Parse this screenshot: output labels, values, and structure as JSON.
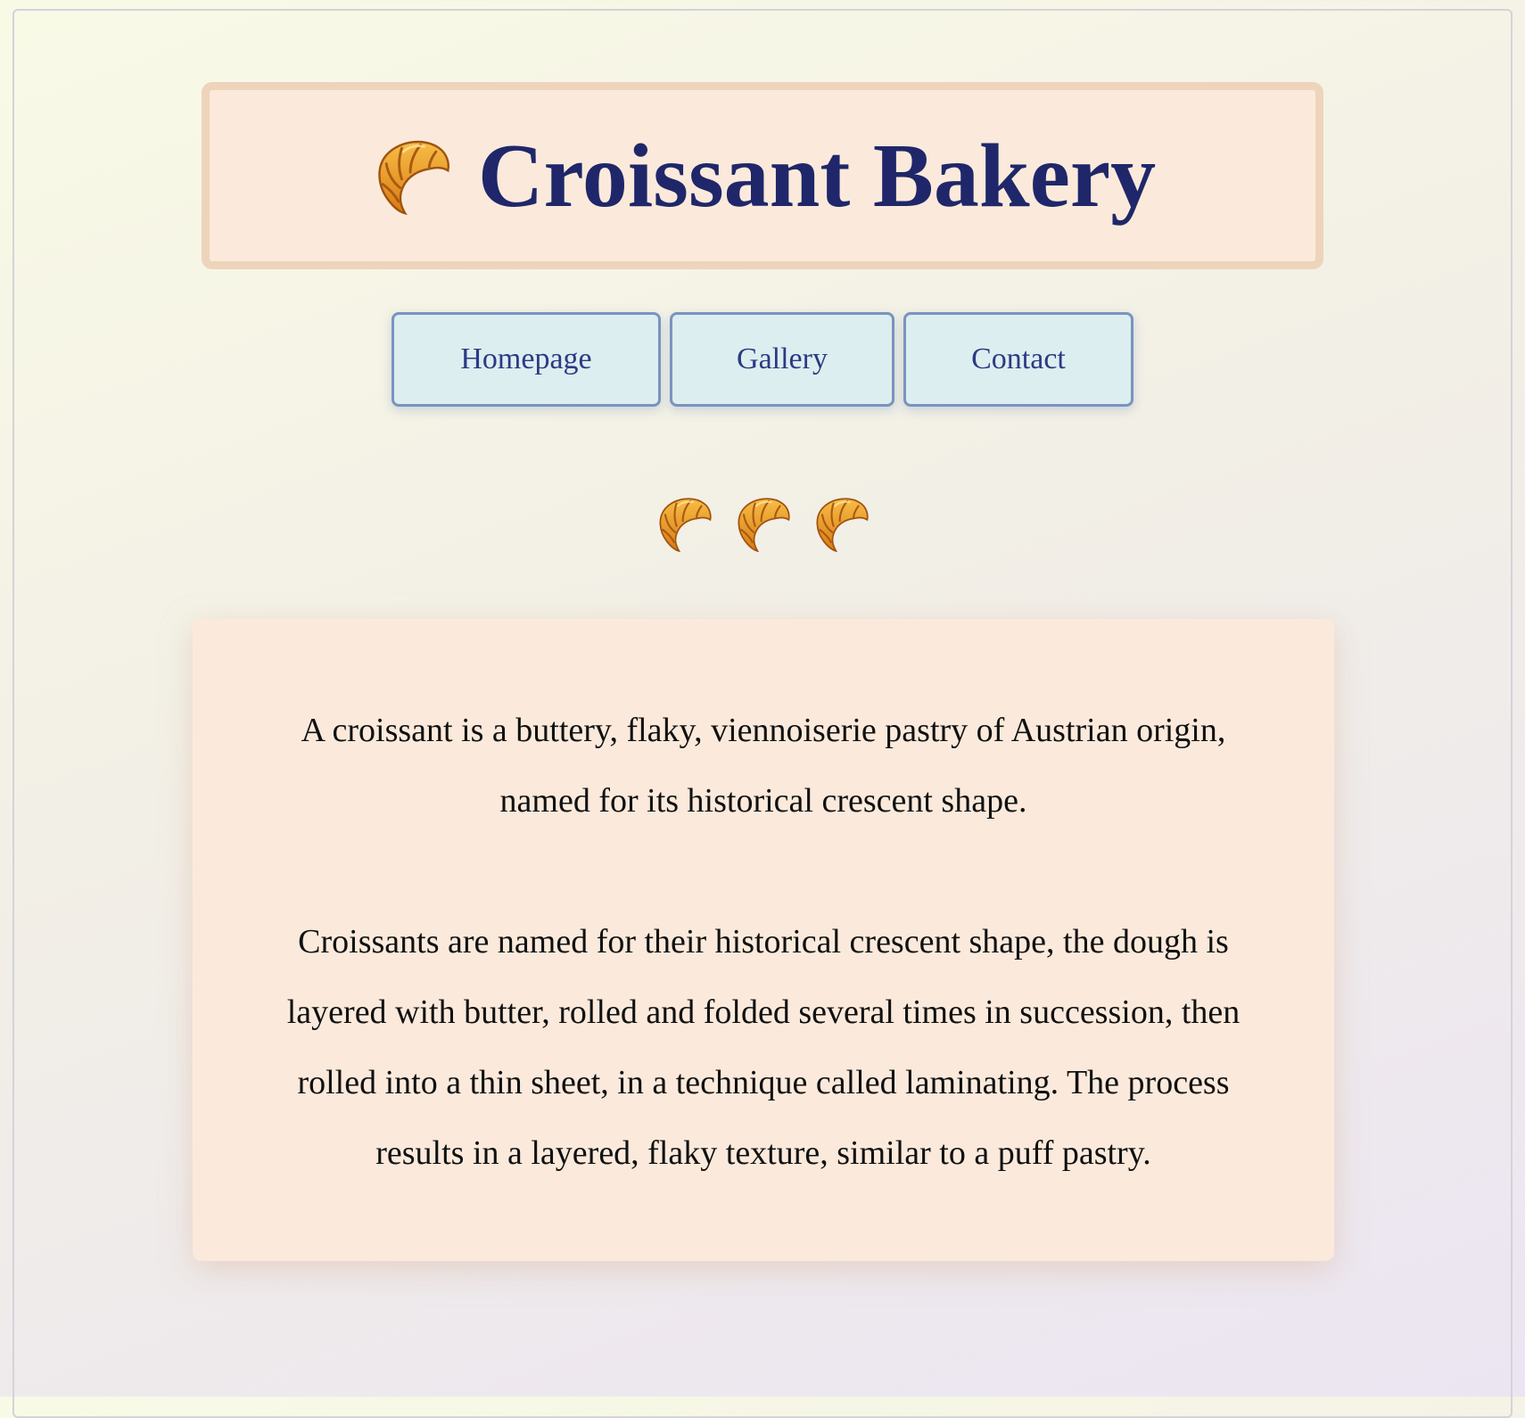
{
  "header": {
    "title": "Croissant Bakery",
    "title_icon": "croissant-icon"
  },
  "nav": {
    "items": [
      {
        "label": "Homepage"
      },
      {
        "label": "Gallery"
      },
      {
        "label": "Contact"
      }
    ]
  },
  "decoration": {
    "icon": "croissant-icon",
    "count": 3
  },
  "content": {
    "paragraphs": [
      "A croissant is a buttery, flaky, viennoiserie pastry of Austrian origin, named for its historical crescent shape.",
      "Croissants are named for their historical crescent shape, the dough is layered with butter, rolled and folded several times in succession, then rolled into a thin sheet, in a technique called laminating. The process results in a layered, flaky texture, similar to a puff pastry."
    ]
  },
  "colors": {
    "title": "#1f276a",
    "header_bg": "#fbeadb",
    "header_border": "#eed4bb",
    "nav_bg": "#ddeef0",
    "nav_border": "#7a94c0",
    "nav_text": "#2c3a84",
    "card_bg": "#fbeadc"
  }
}
